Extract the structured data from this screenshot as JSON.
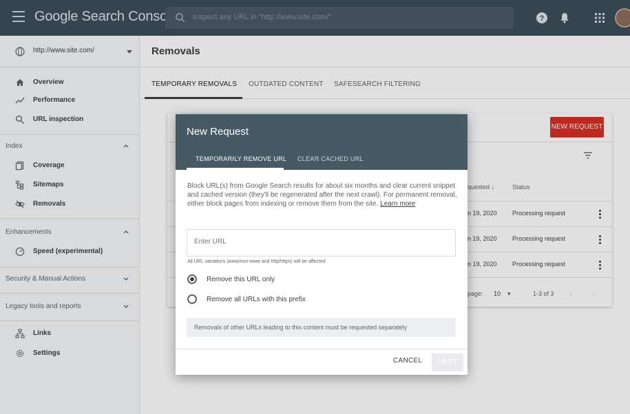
{
  "topbar": {
    "app_name": "Google Search Console",
    "search_placeholder": "Inspect any URL in \"http://www.site.com/\""
  },
  "sidebar": {
    "property": "http://www.site.com/",
    "items": [
      {
        "label": "Overview"
      },
      {
        "label": "Performance"
      },
      {
        "label": "URL inspection"
      }
    ],
    "index_section": "Index",
    "index_items": [
      {
        "label": "Coverage"
      },
      {
        "label": "Sitemaps"
      },
      {
        "label": "Removals"
      }
    ],
    "enhancements_section": "Enhancements",
    "enhancements_items": [
      {
        "label": "Speed (experimental)"
      }
    ],
    "security_section": "Security & Manual Actions",
    "legacy_section": "Legacy tools and reports",
    "bottom_items": [
      {
        "label": "Links"
      },
      {
        "label": "Settings"
      }
    ]
  },
  "main": {
    "title": "Removals",
    "tabs": [
      {
        "label": "TEMPORARY REMOVALS"
      },
      {
        "label": "OUTDATED CONTENT"
      },
      {
        "label": "SAFESEARCH FILTERING"
      }
    ],
    "new_request_label": "NEW REQUEST",
    "table": {
      "col_requested": "quested",
      "col_status": "Status",
      "rows": [
        {
          "date": "n 19, 2020",
          "status": "Processing request"
        },
        {
          "date": "n 19, 2020",
          "status": "Processing request"
        },
        {
          "date": "n 19, 2020",
          "status": "Processing request"
        }
      ],
      "rows_per_page_label": "page:",
      "rows_per_page": "10",
      "range": "1-3 of 3"
    }
  },
  "dialog": {
    "title": "New Request",
    "tabs": [
      {
        "label": "TEMPORARILY REMOVE URL"
      },
      {
        "label": "CLEAR CACHED URL"
      }
    ],
    "description": "Block URL(s) from Google Search results for about six months and clear current snippet and cached version (they'll be regenerated after the next crawl). For permanent removal, either block pages from indexing or remove them from the site.",
    "learn_more": "Learn more",
    "url_placeholder": "Enter URL",
    "url_hint": "All URL variations (www/non-www and http/https) will be affected",
    "option_1": "Remove this URL only",
    "option_2": "Remove all URLs with this prefix",
    "selected_option": "Remove this URL only",
    "note": "Removals of other URLs leading to this content must be requested separately",
    "cancel_label": "CANCEL",
    "next_label": "NEXT"
  },
  "colors": {
    "topbar": "#3d4f5c",
    "dialog_header": "#455a64",
    "accent_red": "#d93025"
  }
}
